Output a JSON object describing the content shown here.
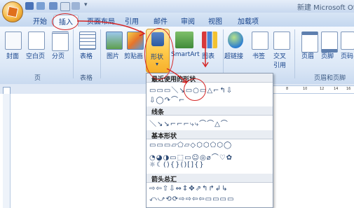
{
  "window": {
    "title": "新建 Microsoft Of"
  },
  "tabs": [
    {
      "label": "开始"
    },
    {
      "label": "插入"
    },
    {
      "label": "页面布局"
    },
    {
      "label": "引用"
    },
    {
      "label": "邮件"
    },
    {
      "label": "审阅"
    },
    {
      "label": "视图"
    },
    {
      "label": "加载项"
    }
  ],
  "ribbon": {
    "commands": [
      {
        "label": "封面",
        "icon": "cover-page-icon"
      },
      {
        "label": "空白页",
        "icon": "blank-page-icon"
      },
      {
        "label": "分页",
        "icon": "page-break-icon"
      },
      {
        "label": "表格",
        "icon": "table-icon"
      },
      {
        "label": "图片",
        "icon": "picture-icon"
      },
      {
        "label": "剪贴画",
        "icon": "clipart-icon"
      },
      {
        "label": "形状",
        "icon": "shapes-icon"
      },
      {
        "label": "SmartArt",
        "icon": "smartart-icon"
      },
      {
        "label": "图表",
        "icon": "chart-icon"
      },
      {
        "label": "超链接",
        "icon": "hyperlink-icon"
      },
      {
        "label": "书签",
        "icon": "bookmark-icon"
      },
      {
        "label": "交叉",
        "label2": "引用",
        "icon": "cross-reference-icon"
      },
      {
        "label": "页眉",
        "icon": "header-icon"
      },
      {
        "label": "页脚",
        "icon": "footer-icon"
      },
      {
        "label": "页码",
        "icon": "page-number-icon"
      }
    ],
    "groups": [
      {
        "label": "页"
      },
      {
        "label": "表格"
      },
      {
        "label": "页眉和页脚"
      }
    ]
  },
  "ruler": {
    "ticks": [
      "8",
      "10",
      "12",
      "14",
      "16"
    ]
  },
  "shapes_menu": {
    "recent": {
      "title": "最近使用的形状",
      "rows": [
        "▭▭▭＼↘▭○▭△⌐↰⇩",
        "⇩◯↷⌒⌐"
      ]
    },
    "lines": {
      "title": "线条",
      "rows": [
        "＼↘↘⌐⌐⌐⤷⤷⌒⌒△⌒"
      ]
    },
    "basic": {
      "title": "基本形状",
      "rows": [
        "▭▭▭▱⬠▱◇⬡⬡⬠⬡◯",
        "◔◕◑▭⬚▭☺◎⌀⌒♡✿",
        "☼☾(){}()[]{}"
      ]
    },
    "arrows": {
      "title": "箭头总汇",
      "rows": [
        "⇨⇦⇧⇩⇔⇕✥⇗↰↱↲↳",
        "⤺⤻⟲⟳⇨⇨⇦⇦▭▭▭▭"
      ]
    }
  }
}
